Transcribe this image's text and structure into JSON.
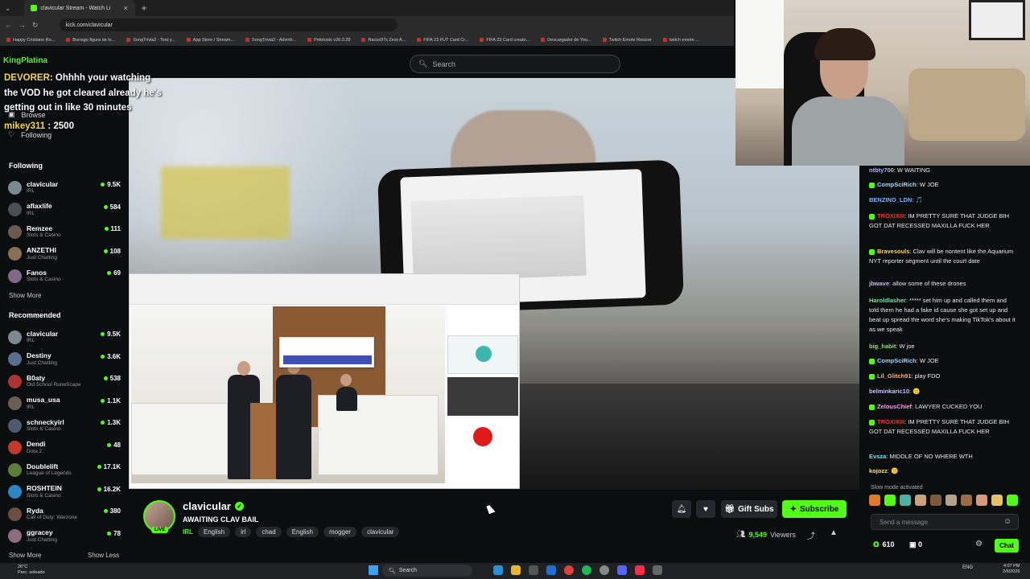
{
  "browser": {
    "tab_title": "clavicular Stream - Watch Li",
    "url": "kick.com/clavicular",
    "bookmarks": [
      "Happy Cristiano Ro...",
      "Burrago figura de lo...",
      "SongTrivia2 - Test y...",
      "App Store / Stream...",
      "SongTrivia2 - Advinh...",
      "Peletools v26.0.28",
      "Racos97s Zest-A...",
      "FIFA 23 FUT Card Cr...",
      "FIFA 23 Card creato...",
      "Descargador de You...",
      "Twitch Emote Resizer",
      "twitch emote ..."
    ]
  },
  "header": {
    "search_placeholder": "Search"
  },
  "overlay": {
    "logo": "KingPlatina",
    "lines": [
      {
        "user": "DEVORER",
        "text": ": Ohhhh your watching"
      },
      {
        "user": "",
        "text": "the VOD he got cleared already he's"
      },
      {
        "user": "",
        "text": "getting out in like 30 minutes"
      },
      {
        "user": "mikey311",
        "text": " : 2500"
      }
    ]
  },
  "sidebar": {
    "nav": [
      {
        "label": "Browse",
        "icon": "browse-icon"
      },
      {
        "label": "Following",
        "icon": "heart-icon"
      }
    ],
    "following_heading": "Following",
    "following": [
      {
        "name": "clavicular",
        "category": "IRL",
        "viewers": "9.5K",
        "color": "#7b8a92"
      },
      {
        "name": "aflaxlife",
        "category": "IRL",
        "viewers": "584",
        "color": "#4a4f55"
      },
      {
        "name": "Remzee",
        "category": "Slots & Casino",
        "viewers": "111",
        "color": "#6a5b4e"
      },
      {
        "name": "ANZETHI",
        "category": "Just Chatting",
        "viewers": "108",
        "color": "#8b6f55"
      },
      {
        "name": "Fanos",
        "category": "Slots & Casino",
        "viewers": "69",
        "color": "#7f6a8a"
      }
    ],
    "show_more": "Show More",
    "recommended_heading": "Recommended",
    "recommended": [
      {
        "name": "clavicular",
        "category": "IRL",
        "viewers": "9.5K",
        "color": "#7b8a92"
      },
      {
        "name": "Destiny",
        "category": "Just Chatting",
        "viewers": "3.6K",
        "color": "#5a6f8f"
      },
      {
        "name": "B0aty",
        "category": "Old School RuneScape",
        "viewers": "538",
        "color": "#a33"
      },
      {
        "name": "musa_usa",
        "category": "IRL",
        "viewers": "1.1K",
        "color": "#6b5f55"
      },
      {
        "name": "schneckyirl",
        "category": "Slots & Casino",
        "viewers": "1.3K",
        "color": "#4d5b6e"
      },
      {
        "name": "Dendi",
        "category": "Dota 2",
        "viewers": "48",
        "color": "#c0392b"
      },
      {
        "name": "Doublelift",
        "category": "League of Legends",
        "viewers": "17.1K",
        "color": "#5b7d3a"
      },
      {
        "name": "ROSHTEIN",
        "category": "Slots & Casino",
        "viewers": "16.2K",
        "color": "#2e86c1"
      },
      {
        "name": "Ryda",
        "category": "Call of Duty: Warzone",
        "viewers": "380",
        "color": "#6d4c41"
      },
      {
        "name": "ggracey",
        "category": "Just Chatting",
        "viewers": "78",
        "color": "#8e6d7f"
      }
    ],
    "show_more_bottom": "Show More",
    "show_less": "Show Less"
  },
  "stream": {
    "streamer": "clavicular",
    "live_badge": "LIVE",
    "title": "AWAITING CLAV BAIL",
    "category": "IRL",
    "tags": [
      "irl",
      "chad",
      "English",
      "mogger",
      "clavicular"
    ],
    "language": "English",
    "gift_subs": "Gift Subs",
    "subscribe": "Subscribe",
    "viewer_count": "9,549",
    "viewers_label": "Viewers"
  },
  "chat": {
    "messages": [
      {
        "user": "ntbty700",
        "text": ": W WAITING",
        "color": "#b0b0ff",
        "badge": false
      },
      {
        "user": "CompSciRich",
        "text": ": W JOE",
        "color": "#9fd7ff",
        "badge": true
      },
      {
        "user": "BENZINO_LDN",
        "text": ": 🎵",
        "color": "#7fb3ff",
        "badge": false
      },
      {
        "user": "TROXIXIII",
        "text": ": IM PRETTY SURE THAT JUDGE BIH GOT DAT RECESSED MAXILLA FUCK HER",
        "color": "#e23b3b",
        "badge": true
      },
      {
        "user": "Bravesouls",
        "text": ": Clav will be nontent like the Aquarium NYT reporter segment until the court date",
        "color": "#ffd84a",
        "badge": true
      },
      {
        "user": "jbwave",
        "text": ": allow some of these drones",
        "color": "#d8b3ff",
        "badge": false
      },
      {
        "user": "Haroldlasher",
        "text": ": ***** set him up and called them and told them he had a fake id cause she got set up and beat up spread the word she's making TikTok's about it as we speak",
        "color": "#7fe0a8",
        "badge": false
      },
      {
        "user": "big_habit",
        "text": ": W joe",
        "color": "#9be36b",
        "badge": false
      },
      {
        "user": "CompSciRich",
        "text": ": W JOE",
        "color": "#9fd7ff",
        "badge": true
      },
      {
        "user": "Lil_Glitch91",
        "text": ": play FDO",
        "color": "#ffb36b",
        "badge": true
      },
      {
        "user": "belminkaric10",
        "text": ": 🙂",
        "color": "#c7c7ff",
        "badge": false
      },
      {
        "user": "ZelousChief",
        "text": ": LAWYER CUCKED YOU",
        "color": "#ff9cf0",
        "badge": true
      },
      {
        "user": "TROXIXIII",
        "text": ": IM PRETTY SURE THAT JUDGE BIH GOT DAT RECESSED MAXILLA FUCK HER",
        "color": "#e23b3b",
        "badge": true
      },
      {
        "user": "Evsza",
        "text": ": MIDDLE OF NO WHERE WTH",
        "color": "#6be6ff",
        "badge": false
      },
      {
        "user": "kojozz",
        "text": ": 🙂",
        "color": "#ffe07a",
        "badge": false
      }
    ],
    "slow_mode": "Slow mode activated",
    "input_placeholder": "Send a message",
    "points": "610",
    "gifts": "0",
    "chat_button": "Chat"
  },
  "taskbar": {
    "weather": "26°C",
    "weather_desc": "Parc. soleado",
    "search": "Search",
    "lang": "ENG",
    "time": "4:07 PM",
    "date": "2/6/2026"
  },
  "colors": {
    "kick_green": "#53fc18",
    "background": "#0b0e0f"
  }
}
